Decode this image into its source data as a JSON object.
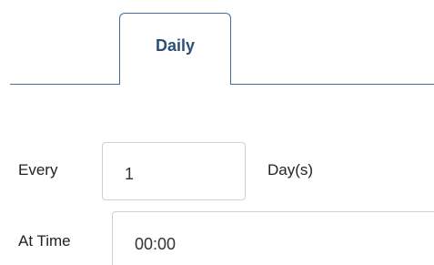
{
  "tabs": [
    {
      "label": "Daily",
      "active": true
    }
  ],
  "form": {
    "every_label": "Every",
    "every_value": "1",
    "every_unit": "Day(s)",
    "time_label": "At Time",
    "time_value": "00:00"
  },
  "colors": {
    "accent": "#3a6ea5",
    "tab_text": "#2b4f79",
    "input_border": "#cfcfcf"
  }
}
